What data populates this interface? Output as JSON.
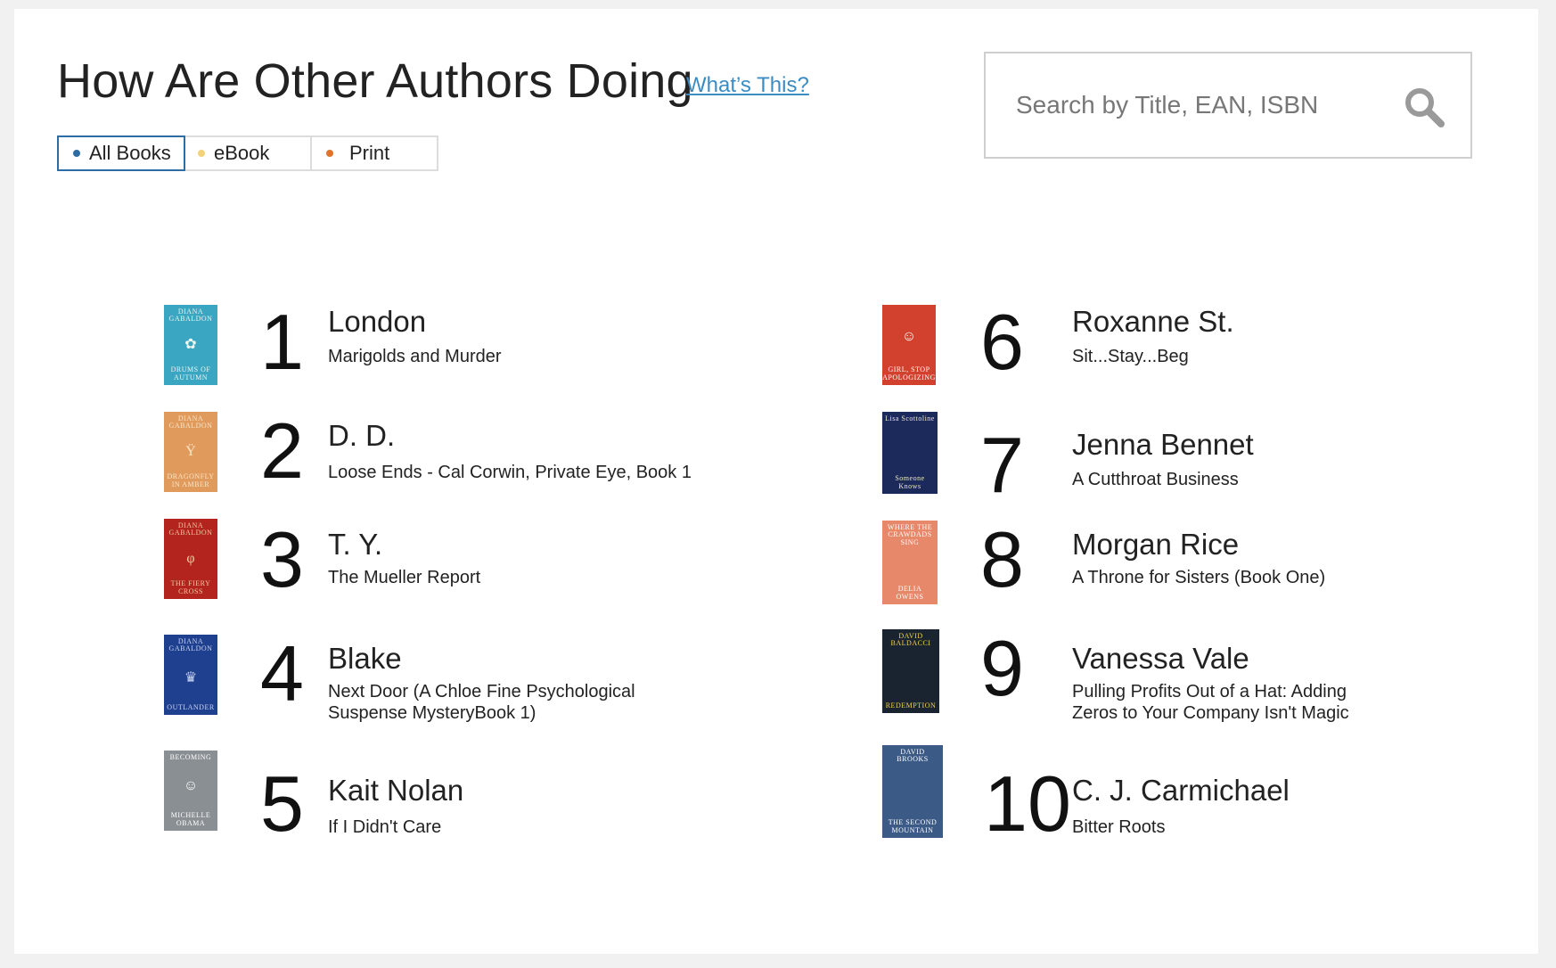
{
  "header": {
    "title": "How Are Other Authors Doing",
    "whats_this": "What’s This?"
  },
  "filters": [
    {
      "label": "All Books",
      "color": "#2e6da4",
      "active": true
    },
    {
      "label": "eBook",
      "color": "#f3d27a",
      "active": false
    },
    {
      "label": "Print",
      "color": "#e0722a",
      "active": false
    }
  ],
  "search": {
    "placeholder": "Search by Title, EAN, ISBN",
    "value": ""
  },
  "rankings": [
    {
      "rank": "1",
      "author": "London",
      "book": "Marigolds and Murder",
      "cover": {
        "bg": "#3aa6c2",
        "fg": "#eaf6f0",
        "top": "DIANA GABALDON",
        "bottom": "DRUMS OF AUTUMN",
        "icon": "tree-icon"
      }
    },
    {
      "rank": "2",
      "author": "D. D.",
      "book": "Loose Ends - Cal Corwin, Private Eye, Book 1",
      "cover": {
        "bg": "#e09a5c",
        "fg": "#fbe6c8",
        "top": "DIANA GABALDON",
        "bottom": "DRAGONFLY IN AMBER",
        "icon": "goblet-icon"
      }
    },
    {
      "rank": "3",
      "author": "T. Y.",
      "book": "The Mueller Report",
      "cover": {
        "bg": "#b3241e",
        "fg": "#f2c9a0",
        "top": "DIANA GABALDON",
        "bottom": "THE FIERY CROSS",
        "icon": "brooch-icon"
      }
    },
    {
      "rank": "4",
      "author": "Blake",
      "book": "Next Door (A Chloe Fine Psychological Suspense MysteryBook 1)",
      "cover": {
        "bg": "#1f3f8f",
        "fg": "#c9d6f2",
        "top": "DIANA GABALDON",
        "bottom": "OUTLANDER",
        "icon": "crown-icon"
      }
    },
    {
      "rank": "5",
      "author": "Kait Nolan",
      "book": "If I Didn't Care",
      "cover": {
        "bg": "#8a8f94",
        "fg": "#ffffff",
        "top": "BECOMING",
        "bottom": "MICHELLE OBAMA",
        "icon": "portrait-icon"
      }
    },
    {
      "rank": "6",
      "author": "Roxanne St.",
      "book": "Sit...Stay...Beg",
      "cover": {
        "bg": "#d2402e",
        "fg": "#ffffff",
        "top": "",
        "bottom": "GIRL, STOP APOLOGIZING",
        "icon": "portrait-icon"
      }
    },
    {
      "rank": "7",
      "author": "Jenna Bennet",
      "book": "A Cutthroat Business",
      "cover": {
        "bg": "#1b2a5a",
        "fg": "#f0e9c4",
        "top": "Lisa Scottoline",
        "bottom": "Someone Knows",
        "icon": ""
      }
    },
    {
      "rank": "8",
      "author": "Morgan Rice",
      "book": "A Throne for Sisters (Book One)",
      "cover": {
        "bg": "#e8886a",
        "fg": "#ffffff",
        "top": "WHERE THE CRAWDADS SING",
        "bottom": "DELIA OWENS",
        "icon": ""
      }
    },
    {
      "rank": "9",
      "author": "Vanessa Vale",
      "book": "Pulling Profits Out of a Hat: Adding Zeros to Your Company Isn't Magic",
      "cover": {
        "bg": "#1a2430",
        "fg": "#f4d24a",
        "top": "DAVID BALDACCI",
        "bottom": "REDEMPTION",
        "icon": ""
      }
    },
    {
      "rank": "10",
      "author": "C. J. Carmichael",
      "book": "Bitter Roots",
      "cover": {
        "bg": "#3c5a86",
        "fg": "#ffffff",
        "top": "DAVID BROOKS",
        "bottom": "THE SECOND MOUNTAIN",
        "icon": ""
      }
    }
  ]
}
